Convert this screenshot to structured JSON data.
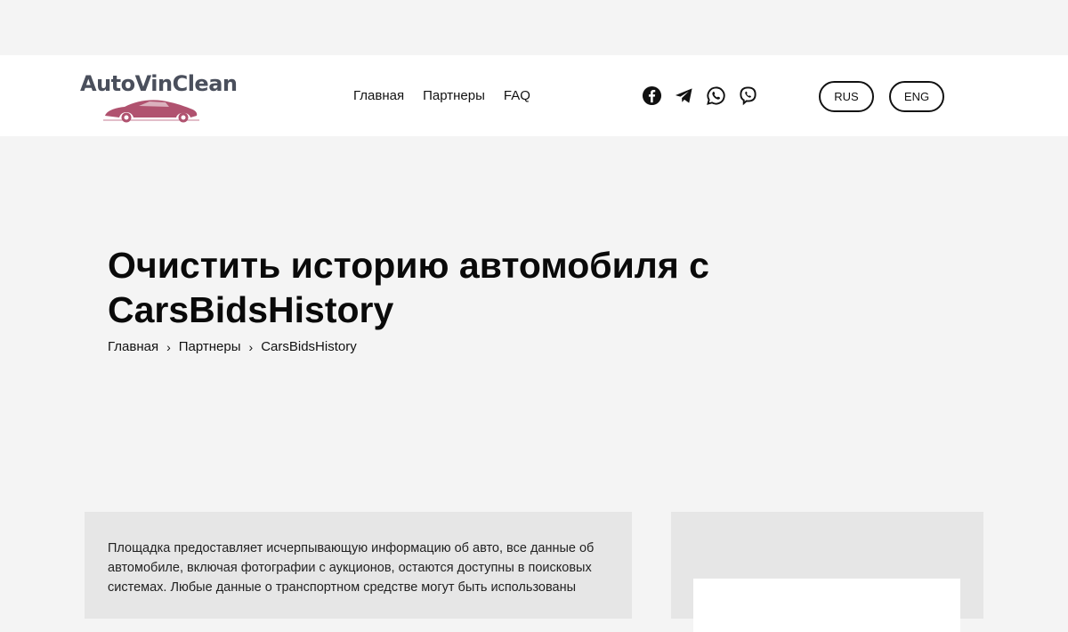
{
  "header": {
    "logo_text": "AutoVinClean",
    "brand_color": "#b0526f",
    "nav": [
      {
        "label": "Главная"
      },
      {
        "label": "Партнеры"
      },
      {
        "label": "FAQ"
      }
    ],
    "social_icons": [
      "facebook-icon",
      "telegram-icon",
      "whatsapp-icon",
      "viber-icon"
    ],
    "languages": {
      "rus": "RUS",
      "eng": "ENG"
    }
  },
  "hero": {
    "title": "Очистить историю автомобиля с CarsBidsHistory",
    "breadcrumb": {
      "home": "Главная",
      "partners": "Партнеры",
      "current": "CarsBidsHistory",
      "separator": "›"
    }
  },
  "content": {
    "paragraph": "Площадка предоставляет исчерпывающую информацию об авто, все данные об автомобиле, включая фотографии с аукционов, остаются доступны в поисковых системах. Любые данные о транспортном средстве могут быть использованы"
  }
}
